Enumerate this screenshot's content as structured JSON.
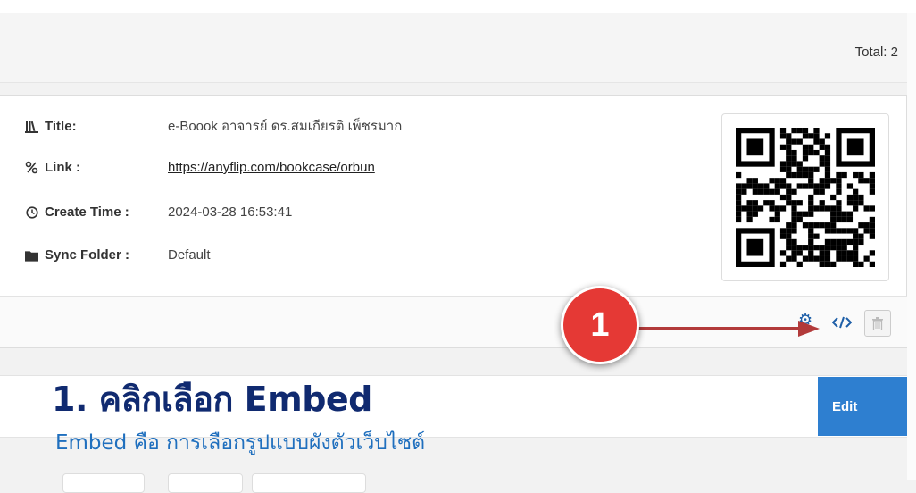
{
  "header": {
    "total": "Total: 2"
  },
  "book": {
    "title_label": "Title:",
    "title_value": "e-Boook อาจารย์ ดร.สมเกียรติ เพ็ชรมาก",
    "link_label": "Link :",
    "link_value": "https://anyflip.com/bookcase/orbun",
    "create_label": "Create Time :",
    "create_value": "2024-03-28 16:53:41",
    "sync_label": "Sync Folder :",
    "sync_value": "Default"
  },
  "buttons": {
    "edit": "Edit"
  },
  "annotation": {
    "badge": "1",
    "title": "1. คลิกเลือก Embed",
    "subtitle": "Embed คือ การเลือกรูปแบบผังตัวเว็บไซต์"
  },
  "colors": {
    "accent": "#2e7fd0",
    "annotation_red": "#e53935",
    "arrow": "#b23a3a",
    "annotation_title": "#102a70",
    "annotation_sub": "#1f6fbe"
  },
  "icons": [
    "library-icon",
    "link-icon",
    "clock-icon",
    "folder-icon",
    "qr-code",
    "gear-icon",
    "embed-code-icon",
    "trash-icon"
  ]
}
